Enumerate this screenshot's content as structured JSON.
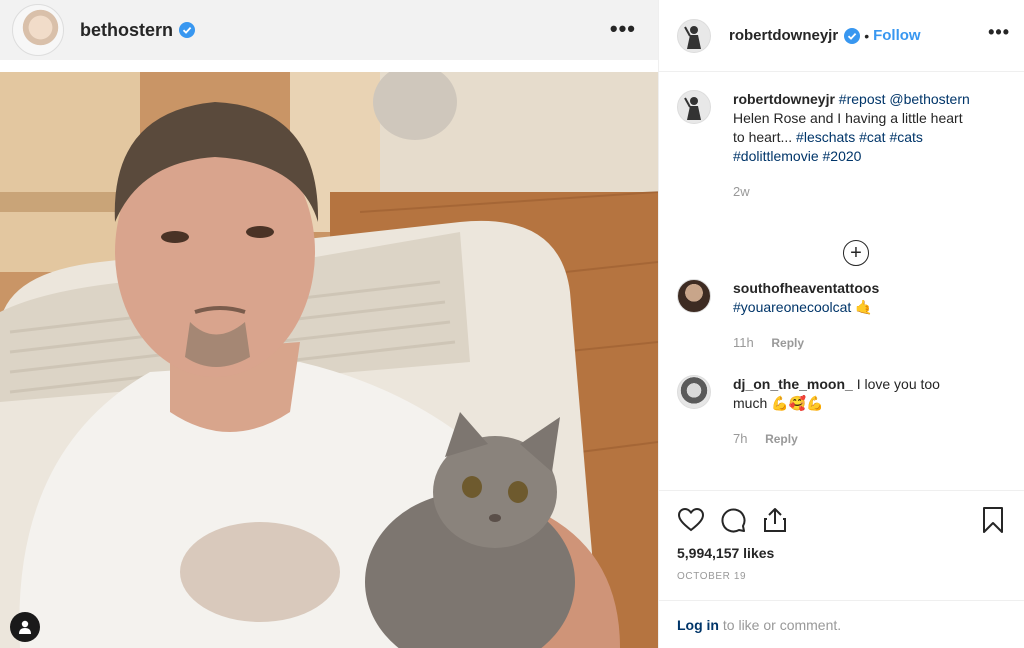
{
  "left": {
    "username": "bethostern",
    "more_label": "•••"
  },
  "right": {
    "username": "robertdowneyjr",
    "separator": "•",
    "follow_label": "Follow",
    "more_label": "•••"
  },
  "caption": {
    "user": "robertdowneyjr",
    "segments": [
      {
        "type": "tag",
        "text": "#repost"
      },
      {
        "type": "tag",
        "text": "@bethostern"
      },
      {
        "type": "text",
        "text": "Helen Rose and I having a little heart to heart..."
      },
      {
        "type": "tag",
        "text": "#leschats"
      },
      {
        "type": "tag",
        "text": "#cat"
      },
      {
        "type": "tag",
        "text": "#cats"
      },
      {
        "type": "tag",
        "text": "#dolittlemovie"
      },
      {
        "type": "tag",
        "text": "#2020"
      }
    ],
    "time": "2w",
    "load_more": "+"
  },
  "comments": [
    {
      "user": "southofheaventattoos",
      "text": "#youareonecoolcat",
      "emoji": "🤙",
      "time": "11h",
      "reply": "Reply"
    },
    {
      "user": "dj_on_the_moon_",
      "text": "I love you too much",
      "emoji": "💪🥰💪",
      "time": "7h",
      "reply": "Reply"
    }
  ],
  "post": {
    "likes": "5,994,157 likes",
    "date": "OCTOBER 19"
  },
  "login_bar": {
    "login": "Log in",
    "rest": "to like or comment."
  },
  "icons": [
    "verified-badge-icon",
    "heart-icon",
    "comment-icon",
    "share-icon",
    "bookmark-icon",
    "user-tag-icon",
    "plus-circle-icon"
  ],
  "colors": {
    "link": "#3897f0",
    "tag": "#003569",
    "verified": "#3897f0",
    "muted": "#999999"
  }
}
